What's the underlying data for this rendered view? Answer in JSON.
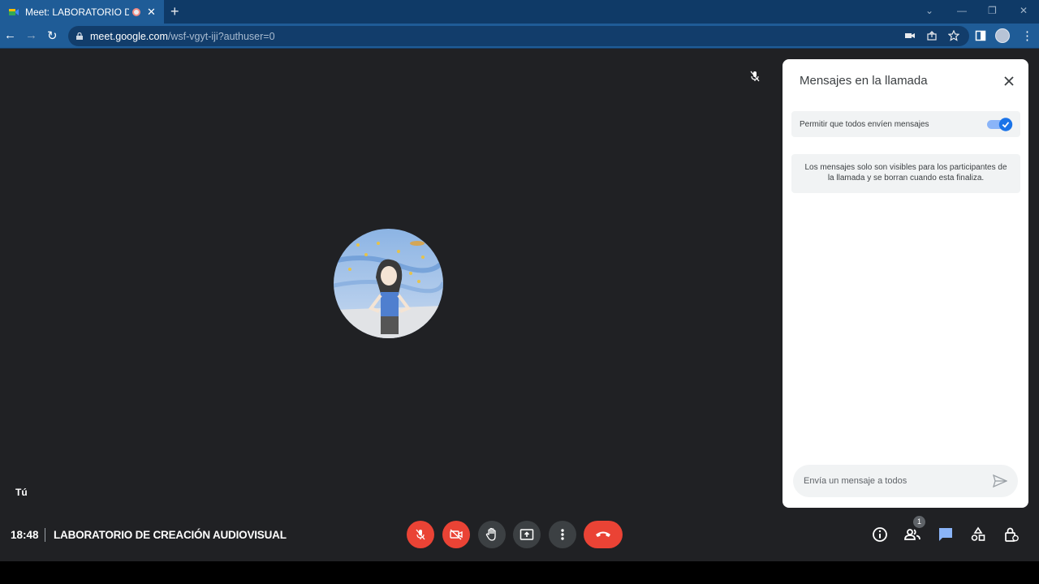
{
  "browser": {
    "tab_title": "Meet: LABORATORIO DE CRE",
    "url_host": "meet.google.com",
    "url_path": "/wsf-vgyt-iji?authuser=0"
  },
  "meet": {
    "self_label": "Tú",
    "time": "18:48",
    "meeting_title": "LABORATORIO DE CREACIÓN AUDIOVISUAL",
    "people_count": "1"
  },
  "panel": {
    "title": "Mensajes en la llamada",
    "permission_label": "Permitir que todos envíen mensajes",
    "permission_enabled": true,
    "info_text": "Los mensajes solo son visibles para los participantes de la llamada y se borran cuando esta finaliza.",
    "input_placeholder": "Envía un mensaje a todos"
  },
  "colors": {
    "meet_bg": "#202124",
    "danger": "#ea4335",
    "accent": "#1a73e8",
    "chrome_tab": "#1f5c97"
  }
}
